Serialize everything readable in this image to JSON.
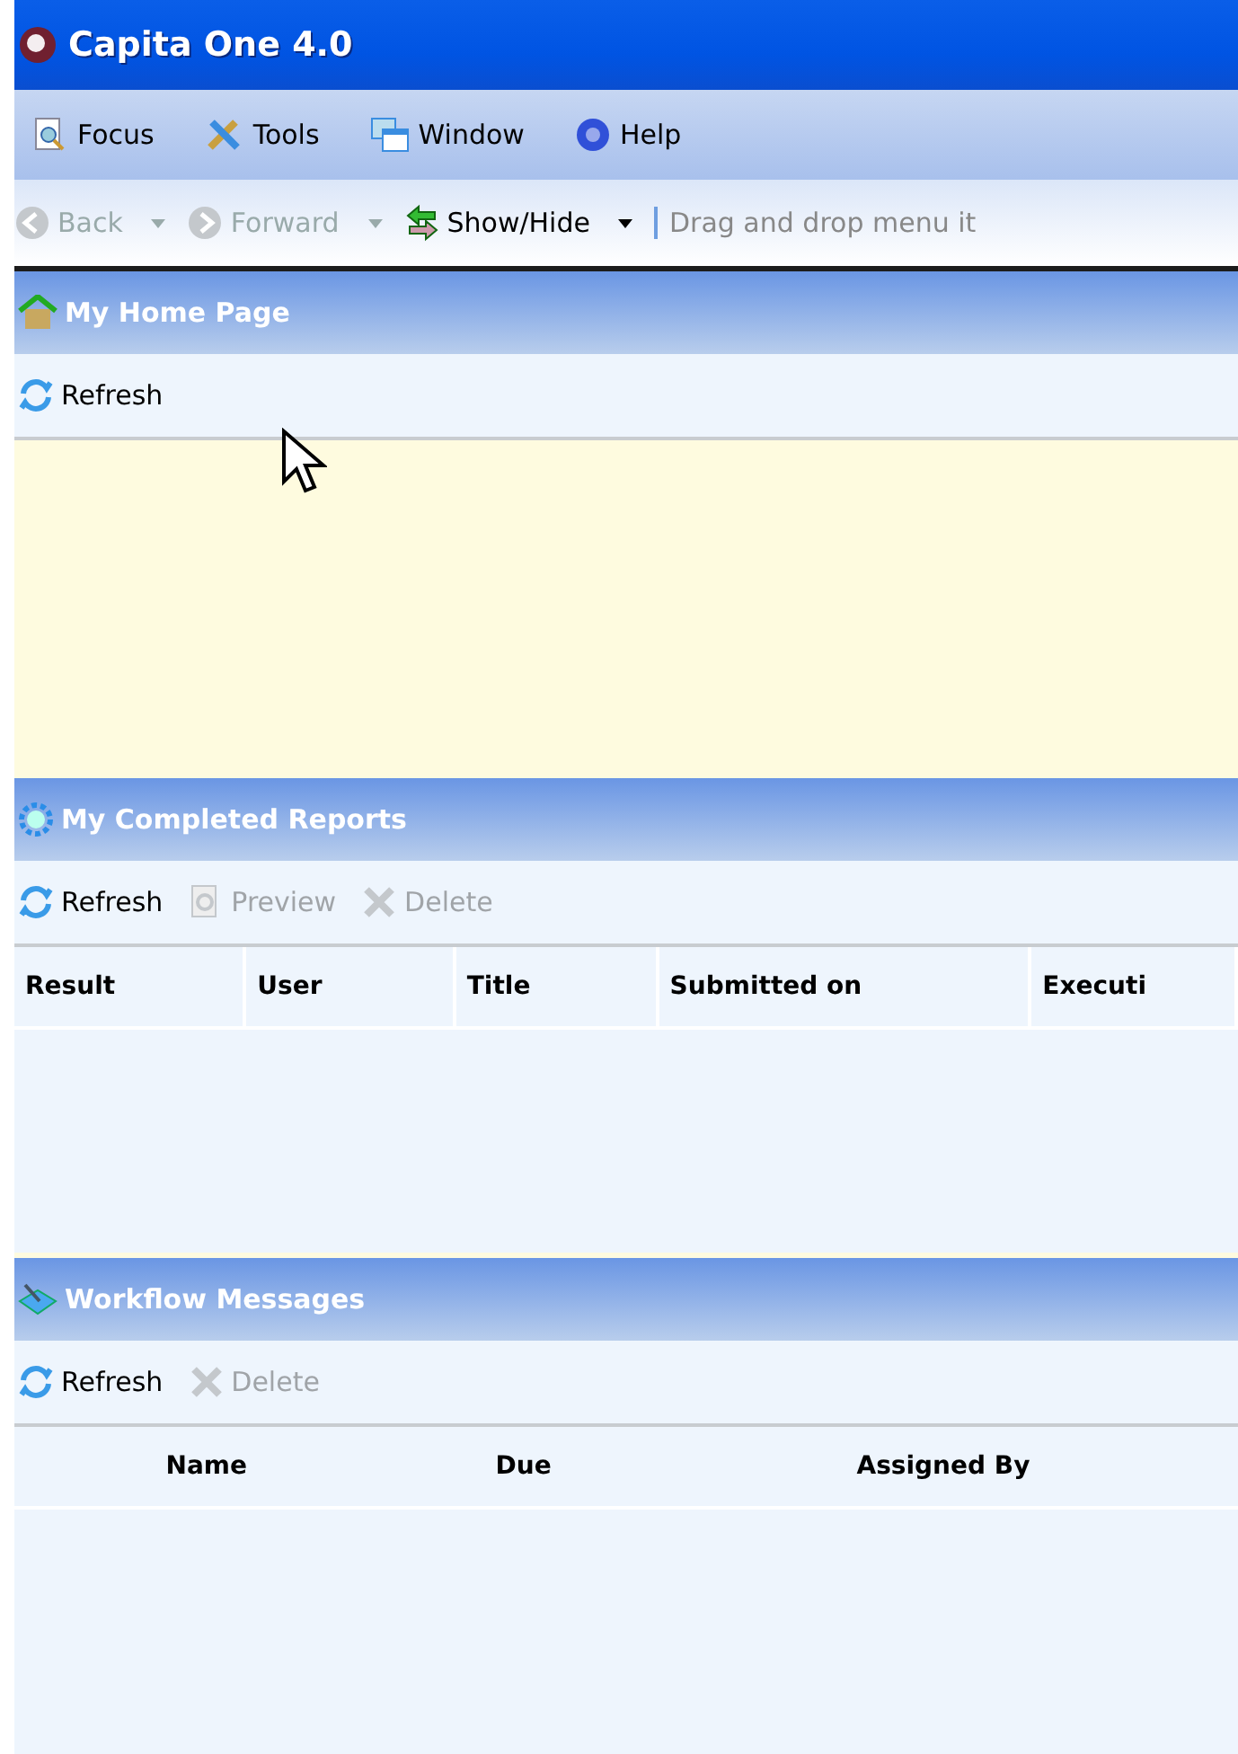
{
  "window": {
    "title": "Capita One 4.0"
  },
  "menu": [
    {
      "label": "Focus"
    },
    {
      "label": "Tools"
    },
    {
      "label": "Window"
    },
    {
      "label": "Help"
    }
  ],
  "toolbar": [
    {
      "kind": "back",
      "label": "Back",
      "disabled": true,
      "dropdown": true
    },
    {
      "kind": "forward",
      "label": "Forward",
      "disabled": true,
      "dropdown": true
    },
    {
      "kind": "toggle",
      "label": "Show/Hide",
      "disabled": false,
      "dropdown": true
    },
    {
      "kind": "hint",
      "label": "Drag and drop menu it"
    }
  ],
  "panels": [
    {
      "kind": "home",
      "title": "My Home Page",
      "actions": [
        {
          "kind": "refresh",
          "label": "Refresh",
          "disabled": false
        }
      ]
    },
    {
      "kind": "reports",
      "title": "My Completed Reports",
      "actions": [
        {
          "kind": "refresh",
          "label": "Refresh",
          "disabled": false
        },
        {
          "kind": "preview",
          "label": "Preview",
          "disabled": true
        },
        {
          "kind": "delete",
          "label": "Delete",
          "disabled": true
        }
      ],
      "columns": [
        "Result",
        "User",
        "Title",
        "Submitted on",
        "Executi"
      ]
    },
    {
      "kind": "messages",
      "title": "Workflow Messages",
      "actions": [
        {
          "kind": "refresh",
          "label": "Refresh",
          "disabled": false
        },
        {
          "kind": "delete",
          "label": "Delete",
          "disabled": true
        }
      ],
      "columns": [
        "Name",
        "Due",
        "Assigned By"
      ]
    }
  ]
}
